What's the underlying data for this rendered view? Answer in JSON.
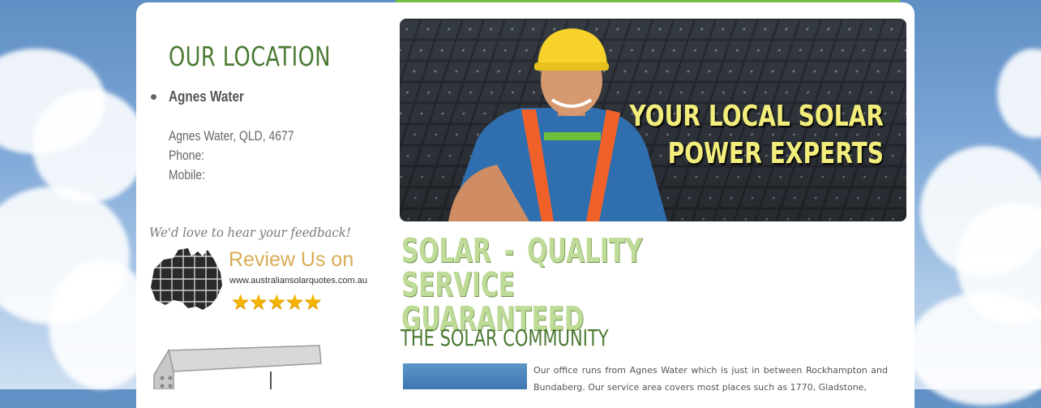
{
  "sidebar": {
    "location_title": "OUR LOCATION",
    "location_name": "Agnes Water",
    "address": "Agnes Water, QLD, 4677",
    "phone_label": "Phone:",
    "mobile_label": "Mobile:",
    "feedback_text": "We'd love to hear your feedback!",
    "review": {
      "heading": "Review Us on",
      "url": "www.australiansolarquotes.com.au",
      "stars": "★★★★★",
      "rating": 5
    }
  },
  "hero": {
    "line1": "YOUR LOCAL SOLAR",
    "line2": "POWER EXPERTS"
  },
  "main": {
    "heading": "SOLAR - QUALITY SERVICE GUARANTEED",
    "subheading": "THE SOLAR COMMUNITY",
    "body": "Our office runs from Agnes Water which is just in between Rockhampton and Bundaberg. Our service area covers most places such as 1770, Gladstone,"
  },
  "colors": {
    "accent_green": "#4b7a33",
    "light_green": "#bedb97",
    "strip_green": "#76c043",
    "hero_text": "#f3ee7c",
    "review_gold": "#d8ad55"
  }
}
